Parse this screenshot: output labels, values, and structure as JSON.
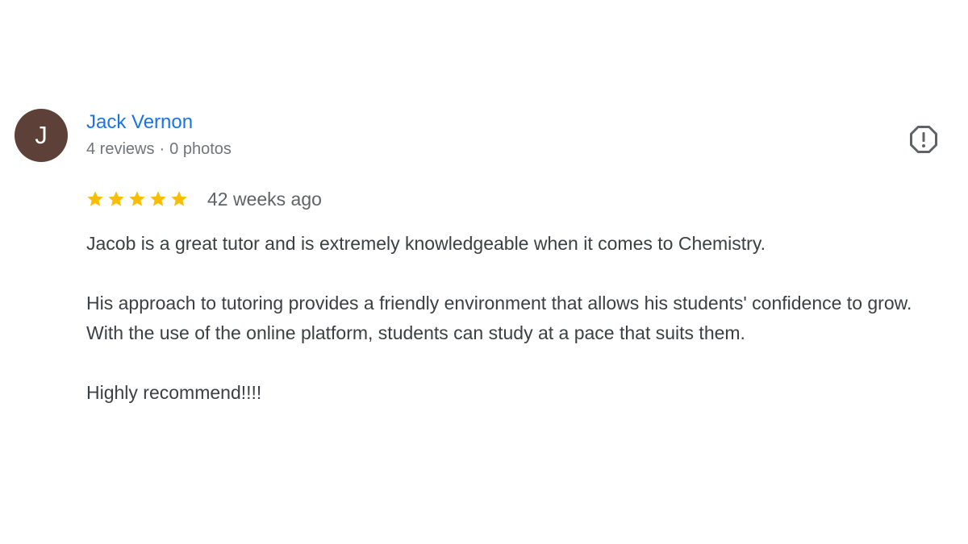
{
  "author": {
    "initial": "J",
    "name": "Jack Vernon",
    "reviews": "4 reviews",
    "separator": "·",
    "photos": "0 photos"
  },
  "rating": {
    "value": 5,
    "max": 5,
    "date": "42 weeks ago"
  },
  "review": {
    "paragraphs": [
      "Jacob is a great tutor and is extremely knowledgeable when it comes to Chemistry.",
      "His approach to tutoring provides a friendly environment that allows his students' confidence to grow. With the use of the online platform, students can study at a pace that suits them.",
      "Highly recommend!!!!"
    ]
  },
  "icons": {
    "report": "report-flag-icon",
    "star": "star-icon"
  },
  "colors": {
    "avatar_bg": "#5d4037",
    "name": "#1a73e8",
    "star": "#fbbc04",
    "report_icon": "#5f6368"
  }
}
